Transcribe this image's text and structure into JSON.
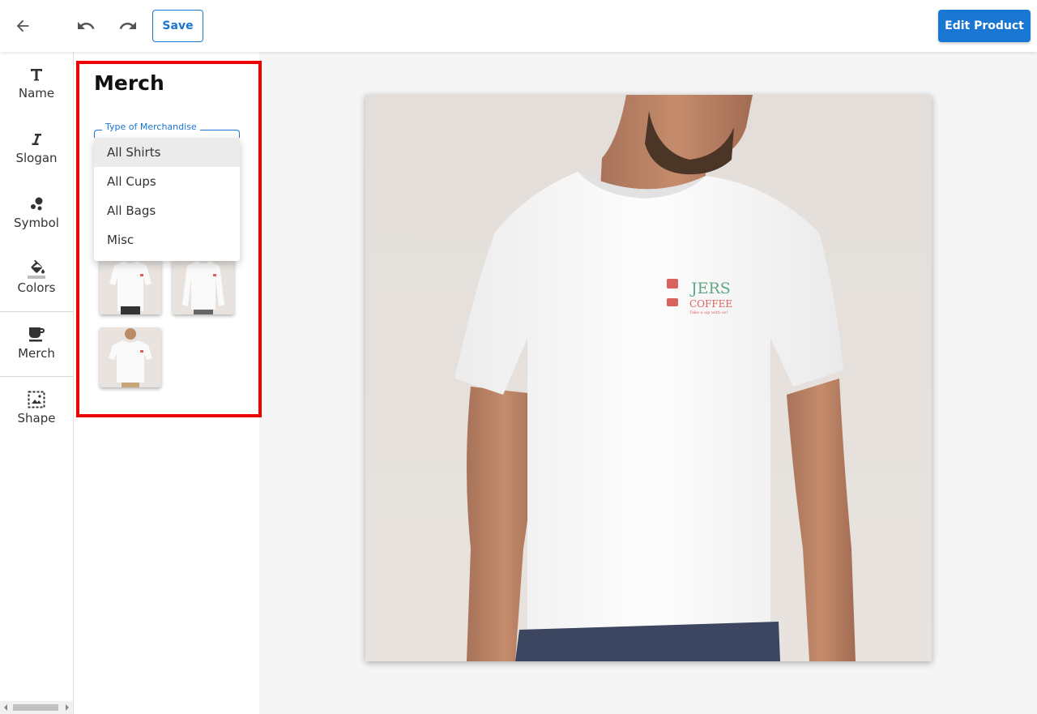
{
  "header": {
    "save_label": "Save",
    "edit_label": "Edit Product"
  },
  "rail": {
    "items": [
      {
        "label": "Name",
        "icon": "text-icon"
      },
      {
        "label": "Slogan",
        "icon": "italic-icon"
      },
      {
        "label": "Symbol",
        "icon": "bubbles-icon"
      },
      {
        "label": "Colors",
        "icon": "paint-bucket-icon"
      },
      {
        "label": "Merch",
        "icon": "cup-icon"
      },
      {
        "label": "Shape",
        "icon": "image-frame-icon"
      }
    ],
    "active": "Merch"
  },
  "panel": {
    "title": "Merch",
    "field_label": "Type of Merchandise",
    "options": [
      "All Shirts",
      "All Cups",
      "All Bags",
      "Misc"
    ],
    "selected": "All Shirts"
  },
  "logo": {
    "word1": "JERS",
    "word2": "COFFEE",
    "tagline": "Take a sip with us!"
  },
  "colors": {
    "accent": "#1976d2",
    "highlight": "#ee0000",
    "logo_green": "#5fa884",
    "logo_red": "#d9625e"
  }
}
